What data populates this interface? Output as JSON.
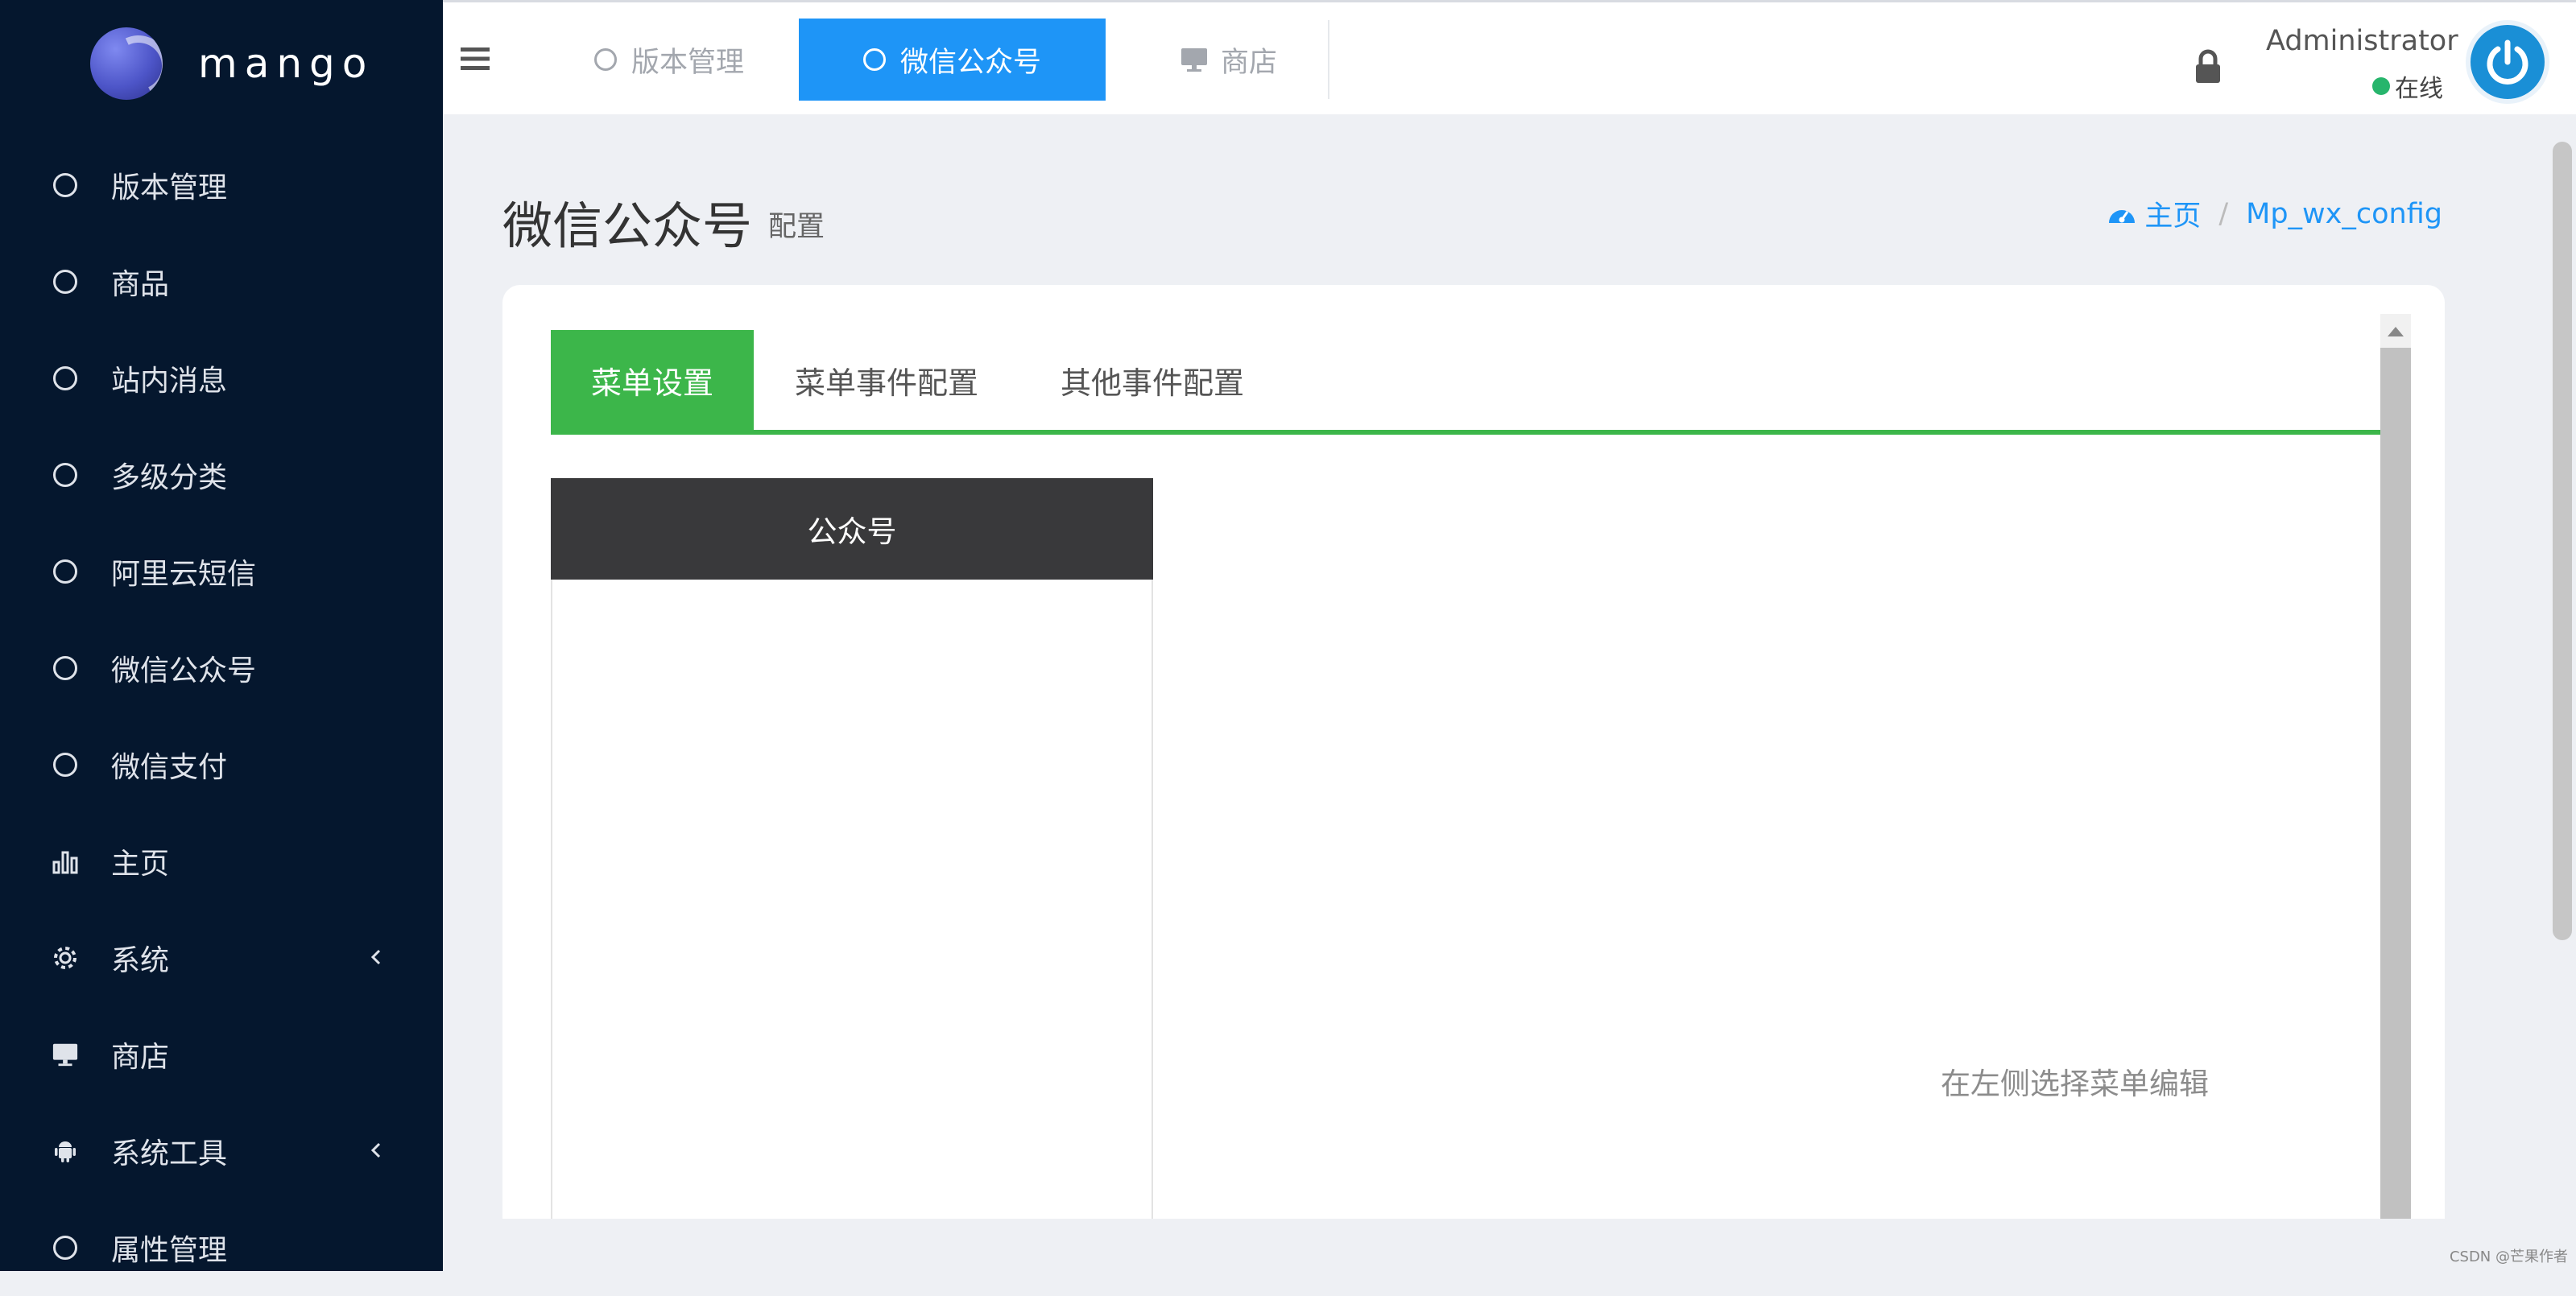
{
  "brand": {
    "name": "mango"
  },
  "sidebar": {
    "items": [
      {
        "label": "版本管理",
        "icon": "circle-icon",
        "has_arrow": false
      },
      {
        "label": "商品",
        "icon": "circle-icon",
        "has_arrow": false
      },
      {
        "label": "站内消息",
        "icon": "circle-icon",
        "has_arrow": false
      },
      {
        "label": "多级分类",
        "icon": "circle-icon",
        "has_arrow": false
      },
      {
        "label": "阿里云短信",
        "icon": "circle-icon",
        "has_arrow": false
      },
      {
        "label": "微信公众号",
        "icon": "circle-icon",
        "has_arrow": false
      },
      {
        "label": "微信支付",
        "icon": "circle-icon",
        "has_arrow": false
      },
      {
        "label": "主页",
        "icon": "bar-chart-icon",
        "has_arrow": false
      },
      {
        "label": "系统",
        "icon": "gear-icon",
        "has_arrow": true
      },
      {
        "label": "商店",
        "icon": "monitor-icon",
        "has_arrow": false
      },
      {
        "label": "系统工具",
        "icon": "android-icon",
        "has_arrow": true
      },
      {
        "label": "属性管理",
        "icon": "circle-icon",
        "has_arrow": false
      }
    ]
  },
  "topbar": {
    "tabs": [
      {
        "label": "版本管理",
        "icon": "circle-icon",
        "active": false
      },
      {
        "label": "微信公众号",
        "icon": "circle-icon",
        "active": true
      },
      {
        "label": "商店",
        "icon": "monitor-icon",
        "active": false
      }
    ],
    "user": {
      "name": "Administrator",
      "status": "在线"
    }
  },
  "page": {
    "title": "微信公众号",
    "subtitle": "配置"
  },
  "breadcrumb": {
    "home": "主页",
    "current": "Mp_wx_config"
  },
  "card": {
    "tabs": [
      {
        "label": "菜单设置",
        "active": true
      },
      {
        "label": "菜单事件配置",
        "active": false
      },
      {
        "label": "其他事件配置",
        "active": false
      }
    ],
    "menu_panel_title": "公众号",
    "hint": "在左侧选择菜单编辑"
  },
  "watermark": "CSDN @芒果作者",
  "colors": {
    "sidebar_bg": "#05172e",
    "accent_blue": "#1e95f7",
    "accent_green": "#3cb64a",
    "panel_header": "#39393b"
  }
}
